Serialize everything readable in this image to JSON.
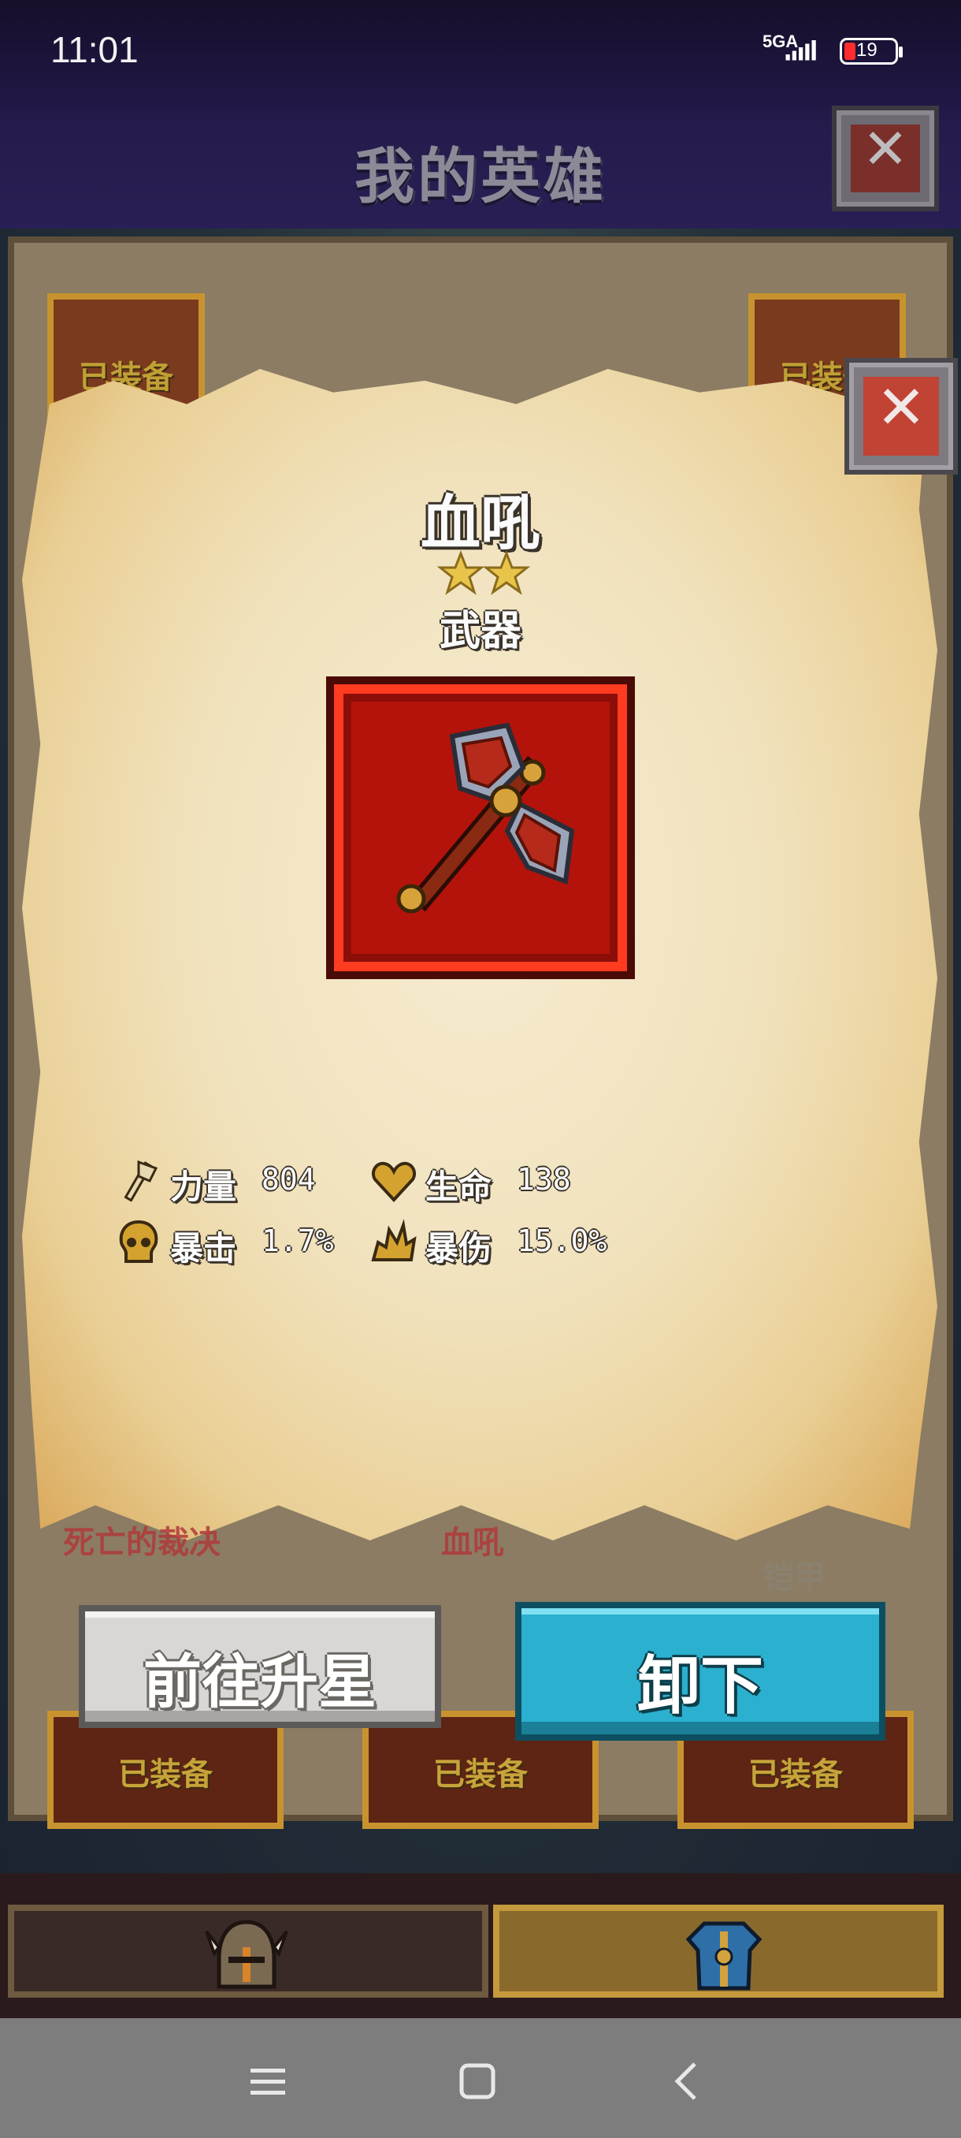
{
  "status_bar": {
    "time": "11:01",
    "network": "5GA",
    "battery_level": "19"
  },
  "header": {
    "title": "我的英雄"
  },
  "item": {
    "name": "血吼",
    "stars": 2,
    "type": "武器",
    "stats": [
      {
        "label": "力量",
        "value": "804",
        "icon": "axe-icon"
      },
      {
        "label": "生命",
        "value": "138",
        "icon": "heart-icon"
      },
      {
        "label": "暴击",
        "value": "1.7%",
        "icon": "skull-icon"
      },
      {
        "label": "暴伤",
        "value": "15.0%",
        "icon": "burst-icon"
      }
    ]
  },
  "background": {
    "equipped_tag": "已装备",
    "faded_labels": [
      "死亡的裁决",
      "血吼",
      "铠甲"
    ]
  },
  "buttons": {
    "upgrade": "前往升星",
    "unequip": "卸下"
  },
  "colors": {
    "accent_red": "#b3130b",
    "accent_cyan": "#2bb0cf",
    "parchment": "#f1e2bd"
  }
}
